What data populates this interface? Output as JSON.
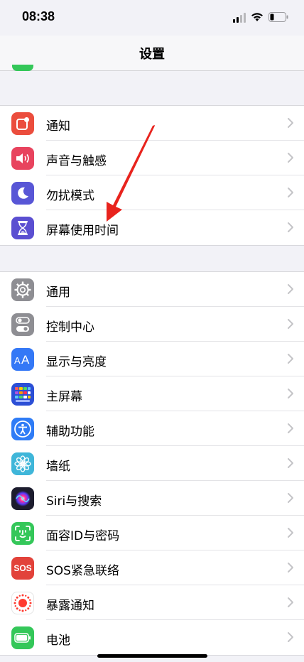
{
  "status": {
    "time": "08:38"
  },
  "nav": {
    "title": "设置"
  },
  "group1": [
    {
      "label": "通知",
      "icon": "notifications-icon",
      "color": "#eb4d3d"
    },
    {
      "label": "声音与触感",
      "icon": "speaker-icon",
      "color": "#e8435e"
    },
    {
      "label": "勿扰模式",
      "icon": "moon-icon",
      "color": "#5856d6"
    },
    {
      "label": "屏幕使用时间",
      "icon": "hourglass-icon",
      "color": "#5b4fd1"
    }
  ],
  "group2": [
    {
      "label": "通用",
      "icon": "gear-icon",
      "color": "#8e8e93"
    },
    {
      "label": "控制中心",
      "icon": "toggles-icon",
      "color": "#8e8e93"
    },
    {
      "label": "显示与亮度",
      "icon": "text-size-icon",
      "color": "#3478f6"
    },
    {
      "label": "主屏幕",
      "icon": "home-grid-icon",
      "color": "#2c4fd6"
    },
    {
      "label": "辅助功能",
      "icon": "accessibility-icon",
      "color": "#2f7cf6"
    },
    {
      "label": "墙纸",
      "icon": "wallpaper-flower-icon",
      "color": "#3fb6d9"
    },
    {
      "label": "Siri与搜索",
      "icon": "siri-icon",
      "color": "#1c1c2e"
    },
    {
      "label": "面容ID与密码",
      "icon": "face-id-icon",
      "color": "#34c759"
    },
    {
      "label": "SOS紧急联络",
      "icon": "sos-icon",
      "color": "#e2423a",
      "icon_text": "SOS"
    },
    {
      "label": "暴露通知",
      "icon": "exposure-icon",
      "color": "#ffffff"
    },
    {
      "label": "电池",
      "icon": "battery-icon",
      "color": "#34c759"
    }
  ]
}
